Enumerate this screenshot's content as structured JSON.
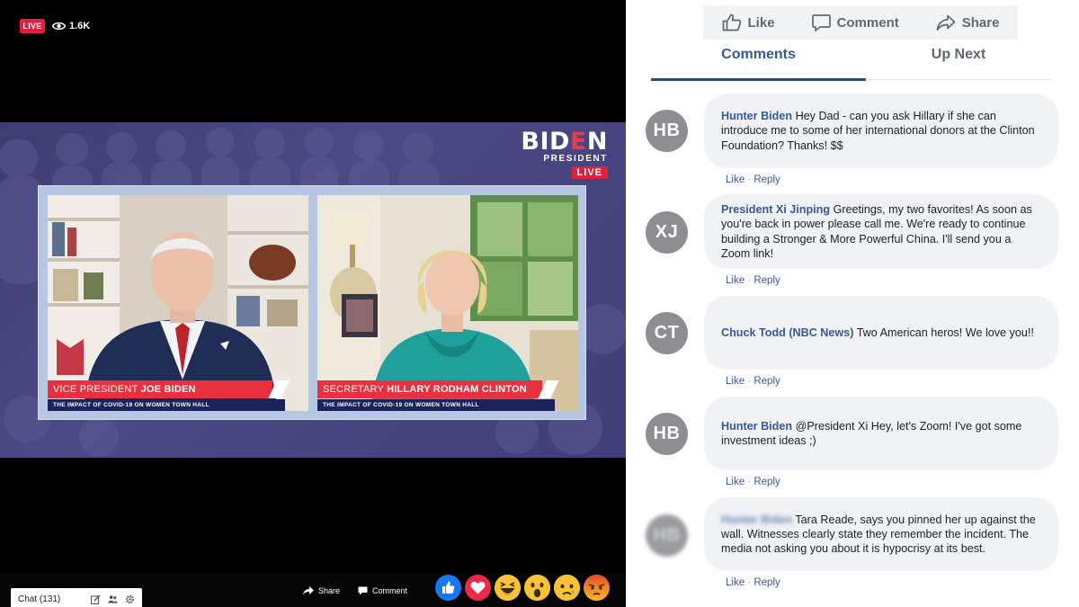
{
  "player": {
    "live_badge": "LIVE",
    "viewer_count": "1.6K",
    "brand": {
      "name_a": "BID",
      "name_b": "E",
      "name_c": "N",
      "subtitle": "PRESIDENT",
      "live": "LIVE"
    },
    "panels": [
      {
        "role": "VICE PRESIDENT",
        "name": "JOE BIDEN",
        "subtitle": "THE IMPACT OF COVID-19 ON WOMEN TOWN HALL"
      },
      {
        "role": "SECRETARY",
        "name": "HILLARY RODHAM CLINTON",
        "subtitle": "THE IMPACT OF COVID-19 ON WOMEN TOWN HALL"
      }
    ],
    "bottom_bar": {
      "chat_label": "Chat (131)",
      "share_label": "Share",
      "comment_label": "Comment",
      "reactions": [
        "like",
        "love",
        "haha",
        "wow",
        "sad",
        "angry"
      ]
    },
    "colors": {
      "live_red": "#e41e3f",
      "stage_purple": "#4b4a86",
      "lower_third_red": "#e8303f",
      "lower_third_navy": "#1b2459"
    }
  },
  "side": {
    "actions": [
      {
        "label": "Like",
        "icon": "thumbs-up-icon"
      },
      {
        "label": "Comment",
        "icon": "comment-icon"
      },
      {
        "label": "Share",
        "icon": "share-arrow-icon"
      }
    ],
    "tabs": [
      {
        "label": "Comments",
        "active": true
      },
      {
        "label": "Up Next",
        "active": false
      }
    ],
    "comments": [
      {
        "initials": "HB",
        "author": "Hunter Biden",
        "text": "Hey Dad - can you ask Hillary if she can introduce me to some of her international donors at the Clinton Foundation? Thanks! $$",
        "like": "Like",
        "reply": "Reply",
        "blurred": false
      },
      {
        "initials": "XJ",
        "author": "President Xi Jinping",
        "text": "Greetings, my two favorites! As soon as you're back in power please call me. We're ready to continue building a Stronger & More Powerful China. I'll send you a Zoom link!",
        "like": "Like",
        "reply": "Reply",
        "blurred": false
      },
      {
        "initials": "CT",
        "author": "Chuck Todd (NBC News)",
        "text": "Two American heros! We love you!!",
        "like": "Like",
        "reply": "Reply",
        "blurred": false
      },
      {
        "initials": "HB",
        "author": "Hunter Biden",
        "text": "@President Xi Hey, let's Zoom! I've got some investment ideas ;)",
        "like": "Like",
        "reply": "Reply",
        "blurred": false
      },
      {
        "initials": "HB",
        "author": "Hunter Biden",
        "text": "Tara Reade, says you pinned her up against the wall. Witnesses clearly state they remember the incident. The media not asking you about it is hypocrisy at its best.",
        "like": "Like",
        "reply": "Reply",
        "blurred": true
      }
    ],
    "colors": {
      "link_blue": "#365899",
      "bubble_gray": "#f0f2f5",
      "avatar_gray": "#8c8e91"
    }
  }
}
